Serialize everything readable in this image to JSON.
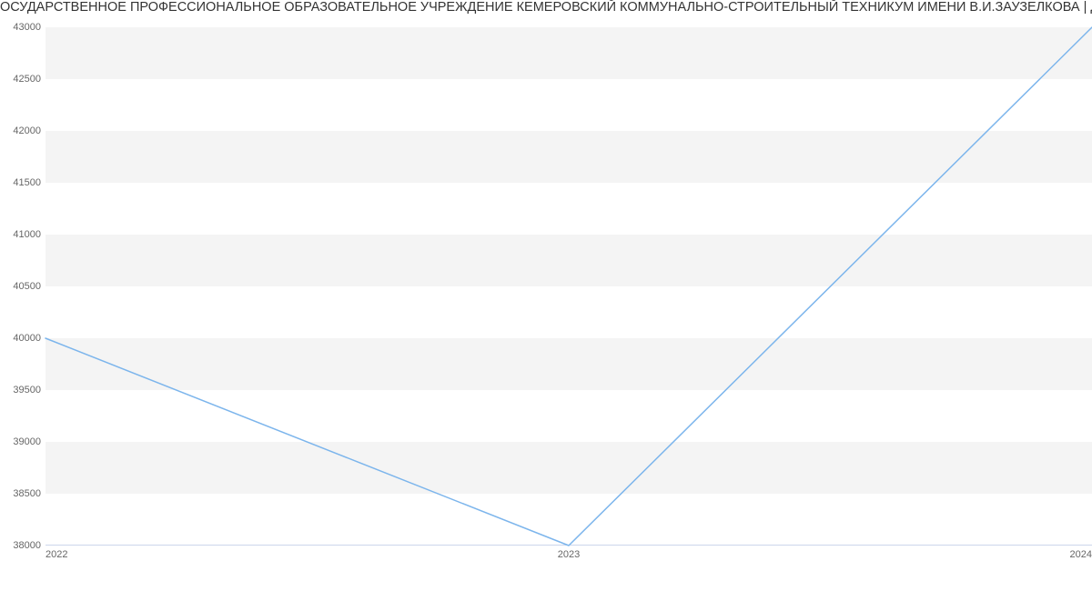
{
  "chart_data": {
    "type": "line",
    "title": "ОСУДАРСТВЕННОЕ ПРОФЕССИОНАЛЬНОЕ ОБРАЗОВАТЕЛЬНОЕ УЧРЕЖДЕНИЕ КЕМЕРОВСКИЙ КОММУНАЛЬНО-СТРОИТЕЛЬНЫЙ ТЕХНИКУМ ИМЕНИ В.И.ЗАУЗЕЛКОВА | Данны",
    "x": [
      2022,
      2023,
      2024
    ],
    "values": [
      40000,
      38000,
      43000
    ],
    "xlabel": "",
    "ylabel": "",
    "ylim": [
      38000,
      43000
    ],
    "y_ticks": [
      38000,
      38500,
      39000,
      39500,
      40000,
      40500,
      41000,
      41500,
      42000,
      42500,
      43000
    ],
    "x_ticks": [
      "2022",
      "2023",
      "2024"
    ],
    "line_color": "#7cb5ec",
    "band_color": "#f4f4f4"
  }
}
